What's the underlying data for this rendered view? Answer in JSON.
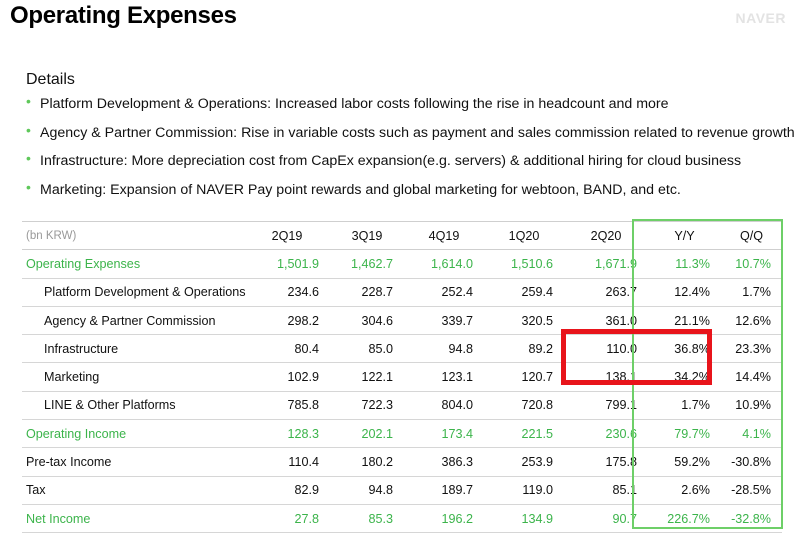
{
  "header": {
    "title": "Operating Expenses",
    "brand": "NAVER"
  },
  "details": {
    "title": "Details",
    "bullets": [
      "Platform Development & Operations: Increased labor costs following the rise in headcount and more",
      "Agency & Partner Commission: Rise in variable costs such as payment and sales commission related to revenue growth",
      "Infrastructure: More depreciation cost from CapEx expansion(e.g. servers) & additional hiring for cloud business",
      "Marketing: Expansion of NAVER Pay point rewards and global marketing for webtoon, BAND, and etc."
    ]
  },
  "table": {
    "unit": "(bn KRW)",
    "columns": [
      "2Q19",
      "3Q19",
      "4Q19",
      "1Q20",
      "2Q20",
      "Y/Y",
      "Q/Q"
    ],
    "rows": [
      {
        "label": "Operating Expenses",
        "values": [
          "1,501.9",
          "1,462.7",
          "1,614.0",
          "1,510.6",
          "1,671.9",
          "11.3%",
          "10.7%"
        ]
      },
      {
        "label": "Platform Development & Operations",
        "values": [
          "234.6",
          "228.7",
          "252.4",
          "259.4",
          "263.7",
          "12.4%",
          "1.7%"
        ]
      },
      {
        "label": "Agency & Partner Commission",
        "values": [
          "298.2",
          "304.6",
          "339.7",
          "320.5",
          "361.0",
          "21.1%",
          "12.6%"
        ]
      },
      {
        "label": "Infrastructure",
        "values": [
          "80.4",
          "85.0",
          "94.8",
          "89.2",
          "110.0",
          "36.8%",
          "23.3%"
        ]
      },
      {
        "label": "Marketing",
        "values": [
          "102.9",
          "122.1",
          "123.1",
          "120.7",
          "138.1",
          "34.2%",
          "14.4%"
        ]
      },
      {
        "label": "LINE & Other Platforms",
        "values": [
          "785.8",
          "722.3",
          "804.0",
          "720.8",
          "799.1",
          "1.7%",
          "10.9%"
        ]
      },
      {
        "label": "Operating Income",
        "values": [
          "128.3",
          "202.1",
          "173.4",
          "221.5",
          "230.6",
          "79.7%",
          "4.1%"
        ]
      },
      {
        "label": "Pre-tax Income",
        "values": [
          "110.4",
          "180.2",
          "386.3",
          "253.9",
          "175.8",
          "59.2%",
          "-30.8%"
        ]
      },
      {
        "label": "Tax",
        "values": [
          "82.9",
          "94.8",
          "189.7",
          "119.0",
          "85.1",
          "2.6%",
          "-28.5%"
        ]
      },
      {
        "label": "Net Income",
        "values": [
          "27.8",
          "85.3",
          "196.2",
          "134.9",
          "90.7",
          "226.7%",
          "-32.8%"
        ]
      }
    ]
  },
  "colors": {
    "accent_green": "#3cb44b",
    "highlight_red": "#e8141b",
    "box_green": "#6ecf68"
  }
}
